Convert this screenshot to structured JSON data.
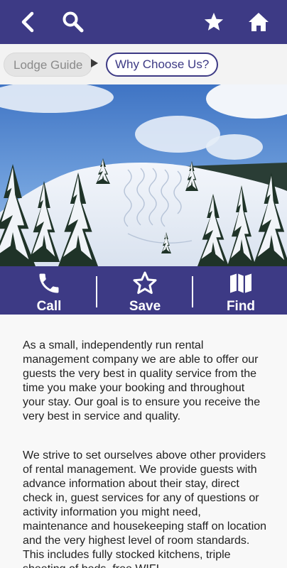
{
  "breadcrumb": {
    "items": [
      "Lodge Guide",
      "Why Choose Us?"
    ]
  },
  "actions": {
    "call": "Call",
    "save": "Save",
    "find": "Find"
  },
  "content": {
    "paragraph1": "As a small, independently run rental management company we are able to offer our guests the very best in quality service from the time you make your booking and throughout your stay. Our goal is to ensure you receive the very best in service and quality.",
    "paragraph2": "We strive to set ourselves above other providers of rental management. We provide guests with advance information about their stay, direct check in, guest services for any of questions or activity information you might need, maintenance and housekeeping staff on location and the very highest level of room standards. This includes fully stocked kitchens, triple sheeting of beds, free WIFI"
  },
  "colors": {
    "brand": "#3d3a85",
    "content_bg": "#f8f8f8"
  },
  "icons": {
    "back": "back-arrow-icon",
    "search": "search-icon",
    "favorite": "star-icon",
    "home": "home-icon",
    "call": "phone-icon",
    "save": "star-outline-icon",
    "find": "map-icon"
  }
}
